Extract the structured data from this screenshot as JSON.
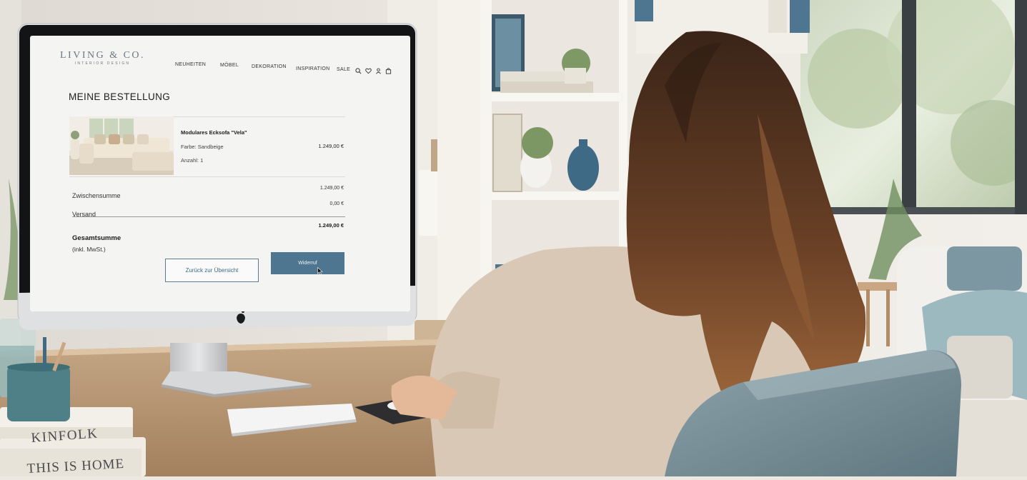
{
  "header": {
    "logo_line1": "LIVING & CO.",
    "logo_line2": "INTERIOR DESIGN",
    "nav": [
      {
        "label": "NEUHEITEN"
      },
      {
        "label": "MÖBEL"
      },
      {
        "label": "DEKORATION"
      },
      {
        "label": "INSPIRATION"
      },
      {
        "label": "SALE"
      }
    ],
    "icons": [
      "search-icon",
      "heart-icon",
      "user-icon",
      "bag-icon"
    ]
  },
  "order": {
    "title": "MEINE BESTELLUNG",
    "product": {
      "name": "Modulares Ecksofa \"Vela\"",
      "color_line": "Farbe: Sandbeige",
      "qty_line": "Anzahl: 1",
      "price": "1.249,00 €"
    },
    "subtotal_label": "Zwischensumme",
    "subtotal_value": "1.249,00 €",
    "shipping_label": "Versand",
    "shipping_value": "0,00 €",
    "total_label": "Gesamtsumme",
    "total_sub": "(inkl. MwSt.)",
    "total_value": "1.249,00 €"
  },
  "actions": {
    "back_label": "Zurück zur Übersicht",
    "revoke_label": "Widerruf"
  },
  "books": {
    "top": "KINFOLK",
    "bottom": "THIS IS HOME"
  },
  "colors": {
    "accent": "#4e7690",
    "button_outline": "#5d7b90"
  }
}
